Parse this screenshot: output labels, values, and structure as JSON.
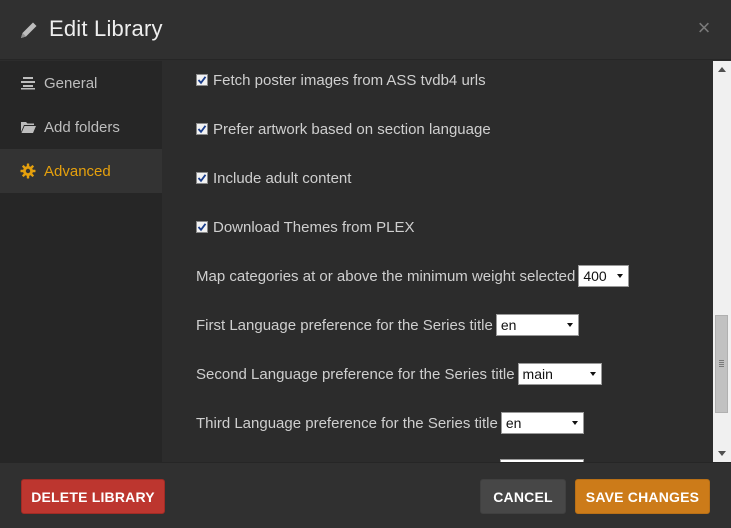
{
  "header": {
    "title": "Edit Library",
    "close_glyph": "×",
    "pencil_icon": "pencil-icon",
    "close_icon": "close-icon"
  },
  "sidebar": {
    "items": [
      {
        "label": "General",
        "icon": "general-lines-icon",
        "active": false
      },
      {
        "label": "Add folders",
        "icon": "folder-icon",
        "active": false
      },
      {
        "label": "Advanced",
        "icon": "gear-icon",
        "active": true
      }
    ]
  },
  "settings": {
    "checkboxes": [
      {
        "label": "Fetch poster images from ASS tvdb4 urls",
        "checked": true
      },
      {
        "label": "Prefer artwork based on section language",
        "checked": true
      },
      {
        "label": "Include adult content",
        "checked": true
      },
      {
        "label": "Download Themes from PLEX",
        "checked": true
      }
    ],
    "selects": [
      {
        "label": "Map categories at or above the minimum weight selected",
        "value": "400"
      },
      {
        "label": "First Language preference for the Series title",
        "value": "en"
      },
      {
        "label": "Second Language preference for the Series title",
        "value": "main"
      },
      {
        "label": "Third Language preference for the Series title",
        "value": "en"
      }
    ]
  },
  "footer": {
    "delete_label": "DELETE LIBRARY",
    "cancel_label": "CANCEL",
    "save_label": "SAVE CHANGES"
  },
  "colors": {
    "accent": "#e5a00d",
    "delete": "#bd362f",
    "save": "#cc7b19",
    "background": "#2c2c2c"
  }
}
